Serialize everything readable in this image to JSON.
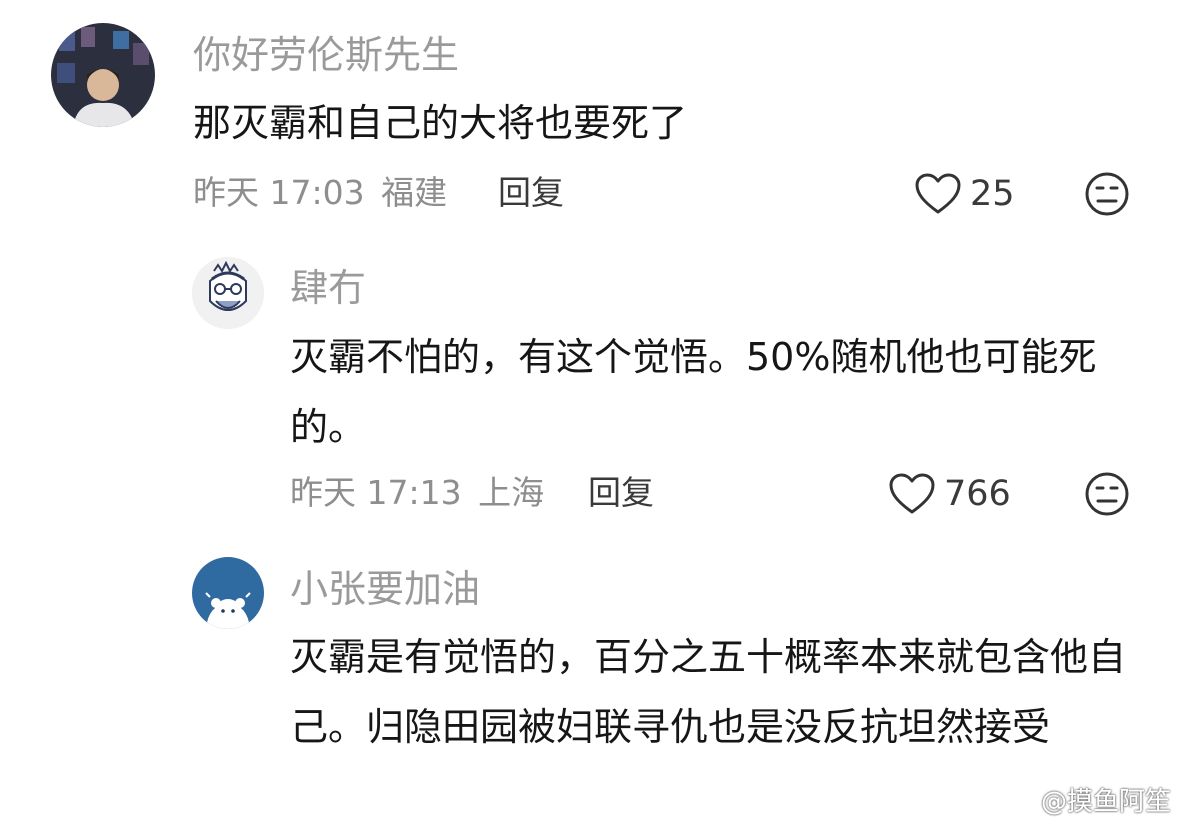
{
  "comments": [
    {
      "username": "你好劳伦斯先生",
      "text": "那灭霸和自己的大将也要死了",
      "time": "昨天 17:03",
      "location": "福建",
      "reply_label": "回复",
      "likes": "25"
    },
    {
      "username": "肆冇",
      "text": "灭霸不怕的，有这个觉悟。50%随机他也可能死的。",
      "time": "昨天 17:13",
      "location": "上海",
      "reply_label": "回复",
      "likes": "766"
    },
    {
      "username": "小张要加油",
      "text": "灭霸是有觉悟的，百分之五十概率本来就包含他自己。归隐田园被妇联寻仇也是没反抗坦然接受"
    }
  ],
  "watermark": "@摸鱼阿笙",
  "icons": {
    "like": "heart-outline-icon",
    "dislike": "meh-face-icon"
  },
  "colors": {
    "username": "#9a9a9a",
    "text": "#161616",
    "meta": "#8e8e8e",
    "action": "#3a3a3a"
  }
}
